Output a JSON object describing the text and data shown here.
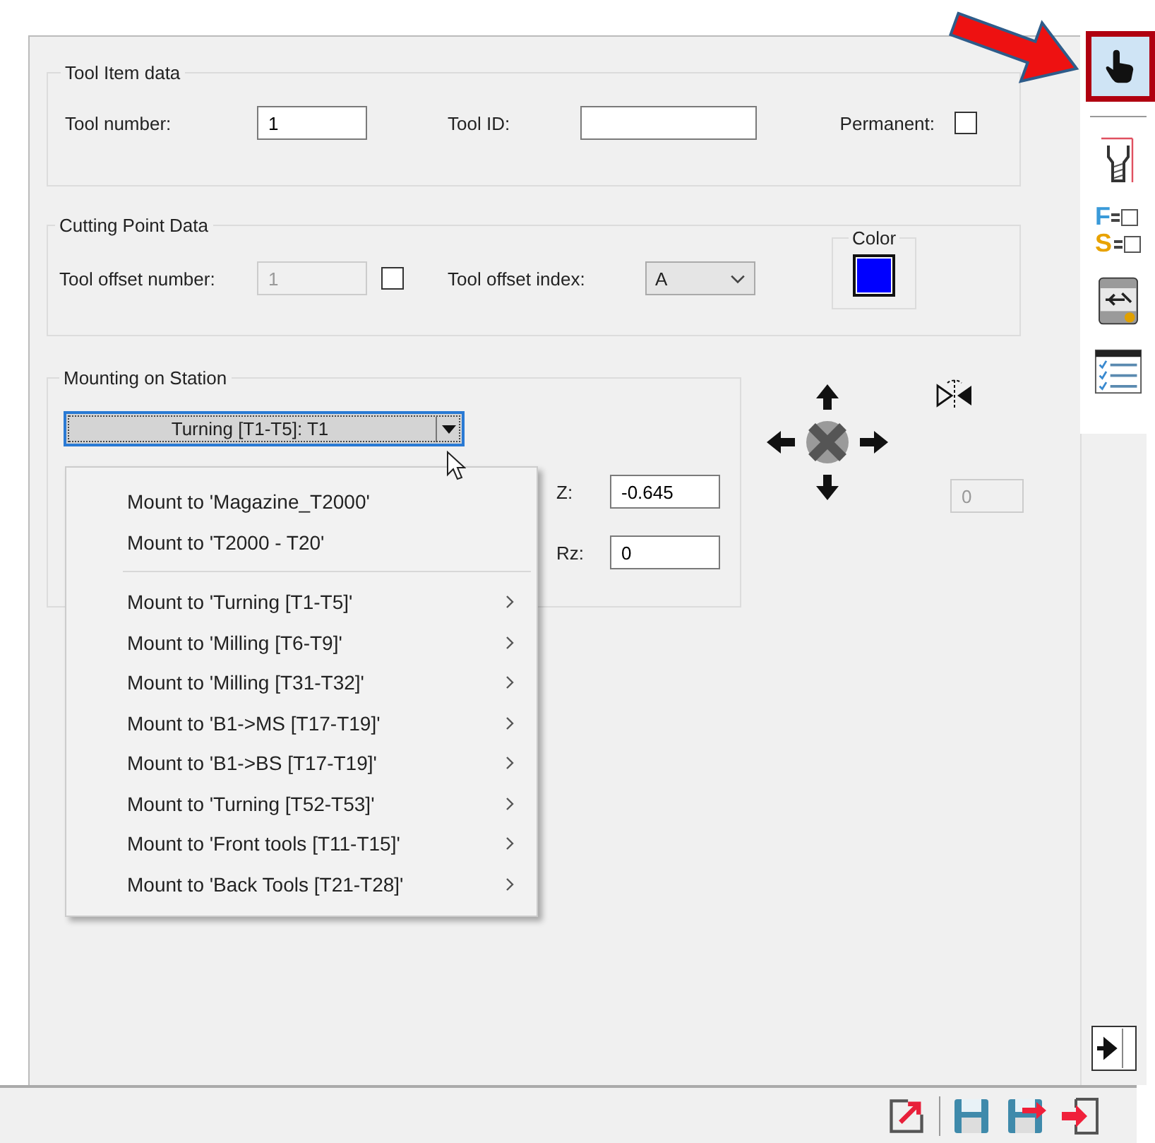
{
  "tool_item_data": {
    "title": "Tool Item data",
    "tool_number": {
      "label": "Tool number:",
      "value": "1"
    },
    "tool_id": {
      "label": "Tool ID:"
    },
    "permanent": {
      "label": "Permanent:",
      "checked": false
    }
  },
  "cutting_point_data": {
    "title": "Cutting Point Data",
    "tool_offset_number": {
      "label": "Tool offset number:",
      "value": "1",
      "disabled": true,
      "checked": false
    },
    "tool_offset_index": {
      "label": "Tool offset index:",
      "value": "A"
    },
    "color": {
      "label": "Color",
      "color": "#0000ff"
    }
  },
  "mounting": {
    "title": "Mounting on Station",
    "station": "Turning [T1-T5]: T1",
    "expanded": true,
    "z": {
      "label": "Z:",
      "value": "-0.645"
    },
    "rz": {
      "label": "Rz:",
      "value": "0"
    },
    "angle": {
      "value": "0",
      "disabled": true
    }
  },
  "menu": {
    "groups": [
      [
        {
          "label": "Mount to 'Magazine_T2000'",
          "submenu": false
        },
        {
          "label": "Mount to 'T2000 - T20'",
          "submenu": false
        }
      ],
      [
        {
          "label": "Mount to 'Turning [T1-T5]'",
          "submenu": true
        },
        {
          "label": "Mount to 'Milling [T6-T9]'",
          "submenu": true
        },
        {
          "label": "Mount to 'Milling [T31-T32]'",
          "submenu": true
        },
        {
          "label": "Mount to 'B1->MS [T17-T19]'",
          "submenu": true
        },
        {
          "label": "Mount to 'B1->BS [T17-T19]'",
          "submenu": true
        },
        {
          "label": "Mount to 'Turning [T52-T53]'",
          "submenu": true
        },
        {
          "label": "Mount to 'Front tools [T11-T15]'",
          "submenu": true
        },
        {
          "label": "Mount to 'Back Tools [T21-T28]'",
          "submenu": true
        }
      ]
    ]
  },
  "toolbar": [
    {
      "kind": "hand",
      "selected": true
    },
    {
      "kind": "dimensions",
      "selected": false
    },
    {
      "kind": "feed-speed",
      "top": "F",
      "bottom": "S",
      "selected": false
    },
    {
      "kind": "machine",
      "selected": false
    },
    {
      "kind": "checklist",
      "selected": false
    }
  ],
  "bottom_toolbar": [
    {
      "kind": "export"
    },
    {
      "kind": "save"
    },
    {
      "kind": "save-as"
    },
    {
      "kind": "exit"
    }
  ]
}
